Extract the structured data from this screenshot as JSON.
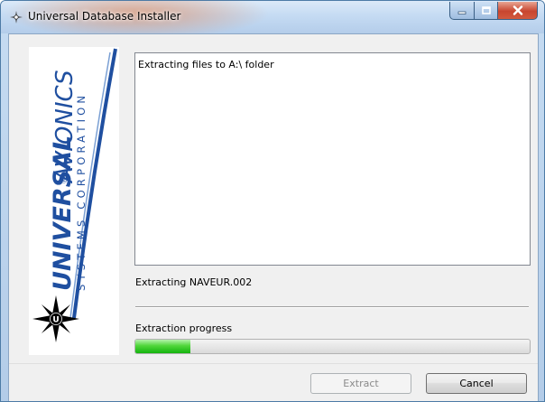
{
  "window": {
    "title": "Universal Database Installer"
  },
  "output": {
    "log_text": "Extracting files to A:\\ folder"
  },
  "status": {
    "current_file_text": "Extracting NAVEUR.002"
  },
  "progress": {
    "label": "Extraction progress",
    "fraction": 0.14
  },
  "buttons": {
    "extract_label": "Extract",
    "cancel_label": "Cancel"
  },
  "logo": {
    "brand": "UNIVERSAL",
    "brand_suffix": "AVIONICS",
    "registered_mark": "®",
    "tagline": "SYSTEMS CORPORATION",
    "emblem_letter": "U"
  },
  "colors": {
    "brand_blue": "#1f4fa0",
    "progress_green": "#22b41b",
    "titlebar_accent": "#e07a45",
    "close_red": "#c8452f"
  },
  "icons": {
    "app": "compass-star-icon",
    "minimize": "minimize-icon",
    "maximize": "maximize-icon",
    "close": "close-icon"
  }
}
